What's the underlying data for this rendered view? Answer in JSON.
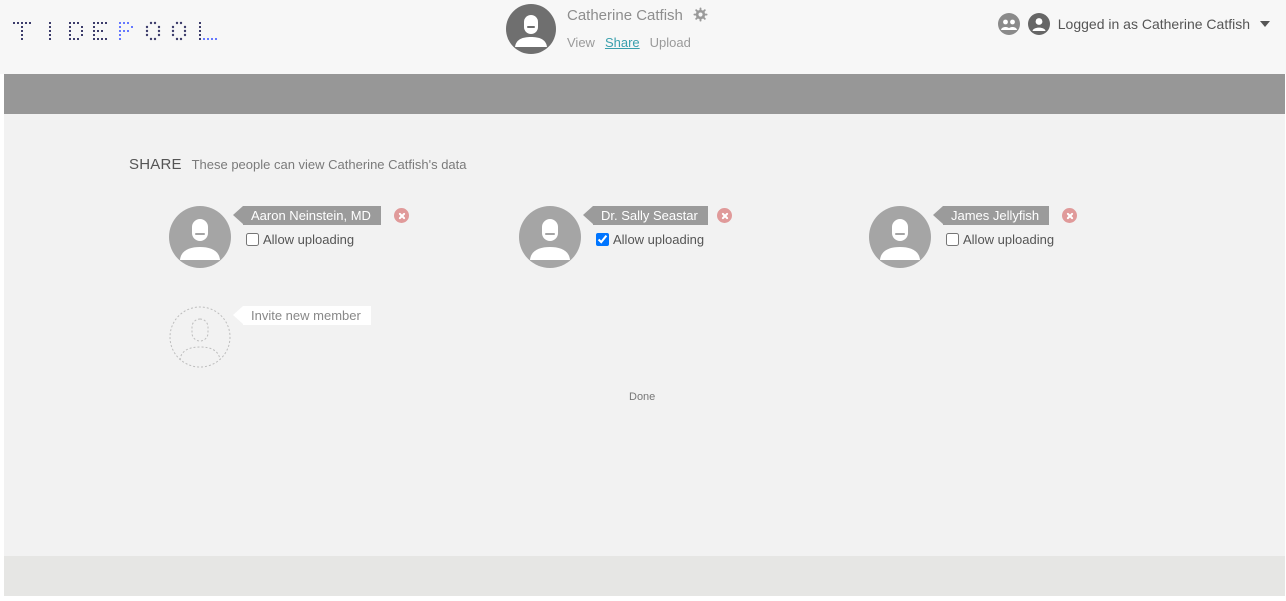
{
  "brand": {
    "logo_text": "TIDEPOOL",
    "accent": "#6578ff"
  },
  "patient": {
    "name": "Catherine Catfish",
    "nav": {
      "view": "View",
      "share": "Share",
      "upload": "Upload"
    }
  },
  "user": {
    "logged_in_label": "Logged in as Catherine Catfish"
  },
  "share": {
    "title": "SHARE",
    "description": "These people can view Catherine Catfish's data",
    "members": [
      {
        "name": "Aaron Neinstein, MD",
        "allow_upload_label": "Allow uploading",
        "allow_upload": false
      },
      {
        "name": "Dr. Sally Seastar",
        "allow_upload_label": "Allow uploading",
        "allow_upload": true
      },
      {
        "name": "James Jellyfish",
        "allow_upload_label": "Allow uploading",
        "allow_upload": false
      }
    ],
    "invite_label": "Invite new member",
    "done_label": "Done"
  },
  "icons": {
    "gear": "gear-icon",
    "care_team": "care-team-icon",
    "user": "user-icon",
    "remove": "remove-icon"
  },
  "colors": {
    "link_active": "#3aa0ad",
    "remove_badge": "#e09a9a",
    "name_tag": "#9b9b9b",
    "checkbox_checked": "#2a74e8"
  }
}
